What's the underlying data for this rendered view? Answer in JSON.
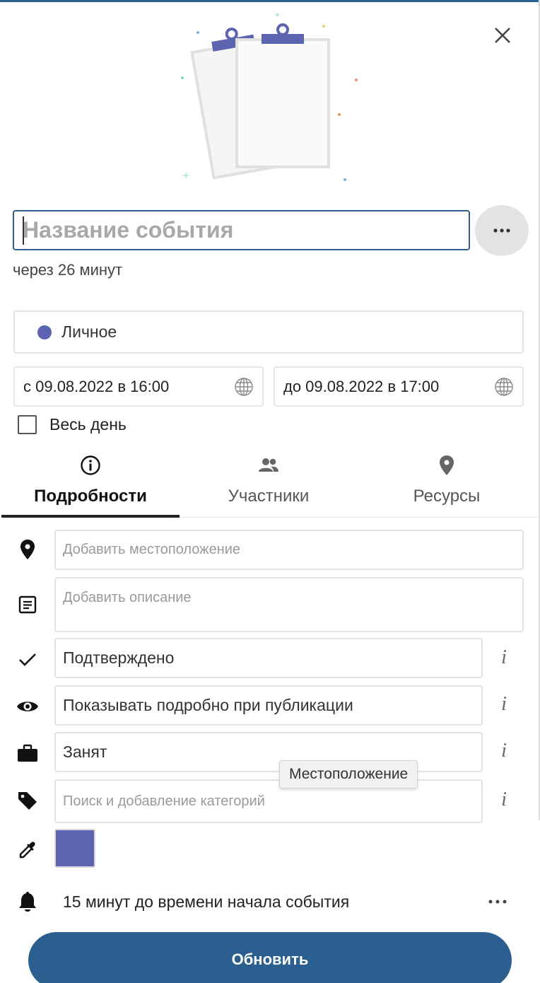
{
  "colors": {
    "accent": "#2a5f8f",
    "calendar": "#5c63b0",
    "border": "#e2e2e2"
  },
  "title_input": {
    "placeholder": "Название события",
    "value": ""
  },
  "relative_time": "через 26 минут",
  "calendar": {
    "name": "Личное",
    "color": "#5c63b0"
  },
  "dates": {
    "from": "с 09.08.2022 в 16:00",
    "to": "до 09.08.2022 в 17:00",
    "timezone_icon": "globe-icon"
  },
  "all_day": {
    "label": "Весь день",
    "checked": false
  },
  "tabs": [
    {
      "label": "Подробности",
      "icon": "info-icon",
      "active": true
    },
    {
      "label": "Участники",
      "icon": "people-icon",
      "active": false
    },
    {
      "label": "Ресурсы",
      "icon": "location-pin-icon",
      "active": false
    }
  ],
  "details": {
    "location_placeholder": "Добавить местоположение",
    "description_placeholder": "Добавить описание",
    "status": "Подтверждено",
    "visibility": "Показывать подробно при публикации",
    "busy": "Занят",
    "category_placeholder": "Поиск и добавление категорий",
    "info_glyph": "i",
    "event_color": "#5c63b0"
  },
  "reminder": {
    "text": "15 минут до времени начала события"
  },
  "tooltip": "Местоположение",
  "update_button": "Обновить"
}
